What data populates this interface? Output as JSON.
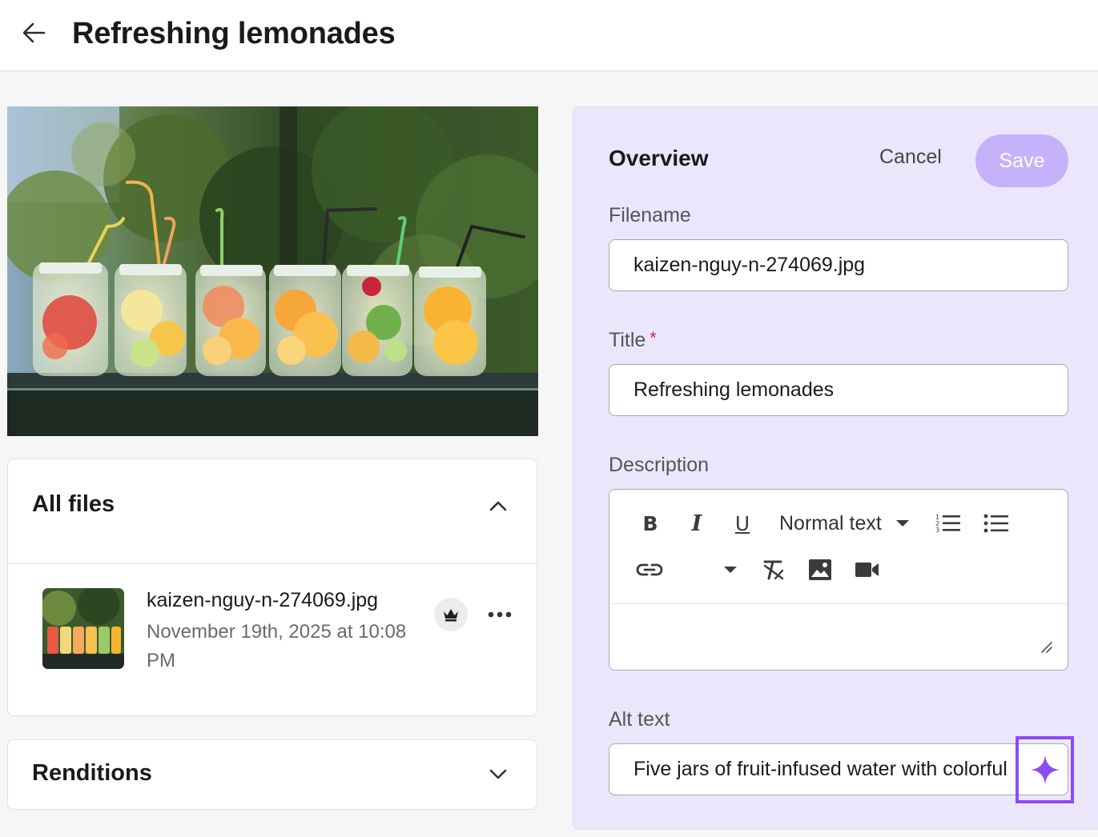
{
  "header": {
    "title": "Refreshing lemonades"
  },
  "all_files": {
    "title": "All files",
    "file": {
      "name": "kaizen-nguy-n-274069.jpg",
      "date": "November 19th, 2025 at 10:08 PM"
    }
  },
  "renditions": {
    "title": "Renditions"
  },
  "overview": {
    "title": "Overview",
    "cancel_label": "Cancel",
    "save_label": "Save",
    "filename_label": "Filename",
    "filename_value": "kaizen-nguy-n-274069.jpg",
    "title_label": "Title",
    "title_required_mark": "*",
    "title_value": "Refreshing lemonades",
    "description_label": "Description",
    "editor": {
      "bold_label": "B",
      "italic_label": "I",
      "underline_label": "U",
      "format_value": "Normal text"
    },
    "alt_label": "Alt text",
    "alt_value": "Five jars of fruit-infused water with colorful"
  },
  "colors": {
    "accent": "#8b4cf6",
    "save_disabled": "#c5b2fb",
    "panel_bg": "#ece6fd",
    "required": "#d0233a"
  },
  "icons": {
    "back": "arrow-left-icon",
    "collapse": "chevron-up-icon",
    "expand": "chevron-down-icon",
    "premium": "crown-icon",
    "more": "more-horizontal-icon",
    "ai": "sparkle-icon"
  }
}
